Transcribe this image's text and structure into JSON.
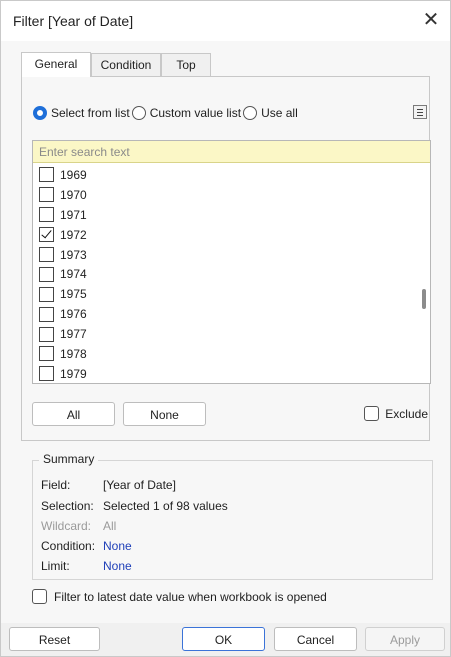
{
  "window": {
    "title": "Filter [Year of Date]",
    "close_symbol": "✕"
  },
  "tabs": [
    {
      "label": "General",
      "active": true
    },
    {
      "label": "Condition",
      "active": false
    },
    {
      "label": "Top",
      "active": false
    }
  ],
  "mode": {
    "options": [
      {
        "label": "Select from list",
        "selected": true
      },
      {
        "label": "Custom value list",
        "selected": false
      },
      {
        "label": "Use all",
        "selected": false
      }
    ]
  },
  "search": {
    "placeholder": "Enter search text",
    "value": ""
  },
  "list": {
    "items": [
      {
        "label": "1969",
        "checked": false
      },
      {
        "label": "1970",
        "checked": false
      },
      {
        "label": "1971",
        "checked": false
      },
      {
        "label": "1972",
        "checked": true
      },
      {
        "label": "1973",
        "checked": false
      },
      {
        "label": "1974",
        "checked": false
      },
      {
        "label": "1975",
        "checked": false
      },
      {
        "label": "1976",
        "checked": false
      },
      {
        "label": "1977",
        "checked": false
      },
      {
        "label": "1978",
        "checked": false
      },
      {
        "label": "1979",
        "checked": false
      }
    ]
  },
  "selection_buttons": {
    "all_label": "All",
    "none_label": "None"
  },
  "exclude": {
    "label": "Exclude",
    "checked": false
  },
  "summary": {
    "legend": "Summary",
    "rows": [
      {
        "key": "Field:",
        "value": "[Year of Date]",
        "style": "normal"
      },
      {
        "key": "Selection:",
        "value": "Selected 1 of 98 values",
        "style": "normal"
      },
      {
        "key": "Wildcard:",
        "value": "All",
        "style": "muted"
      },
      {
        "key": "Condition:",
        "value": "None",
        "style": "link"
      },
      {
        "key": "Limit:",
        "value": "None",
        "style": "link"
      }
    ]
  },
  "latest_date": {
    "label": "Filter to latest date value when workbook is opened",
    "checked": false
  },
  "footer": {
    "reset_label": "Reset",
    "ok_label": "OK",
    "cancel_label": "Cancel",
    "apply_label": "Apply"
  },
  "colors": {
    "accent": "#1e6fd9",
    "search_bg": "#fbf7c6",
    "link": "#1f3fb8",
    "muted": "#9a9a9a"
  }
}
